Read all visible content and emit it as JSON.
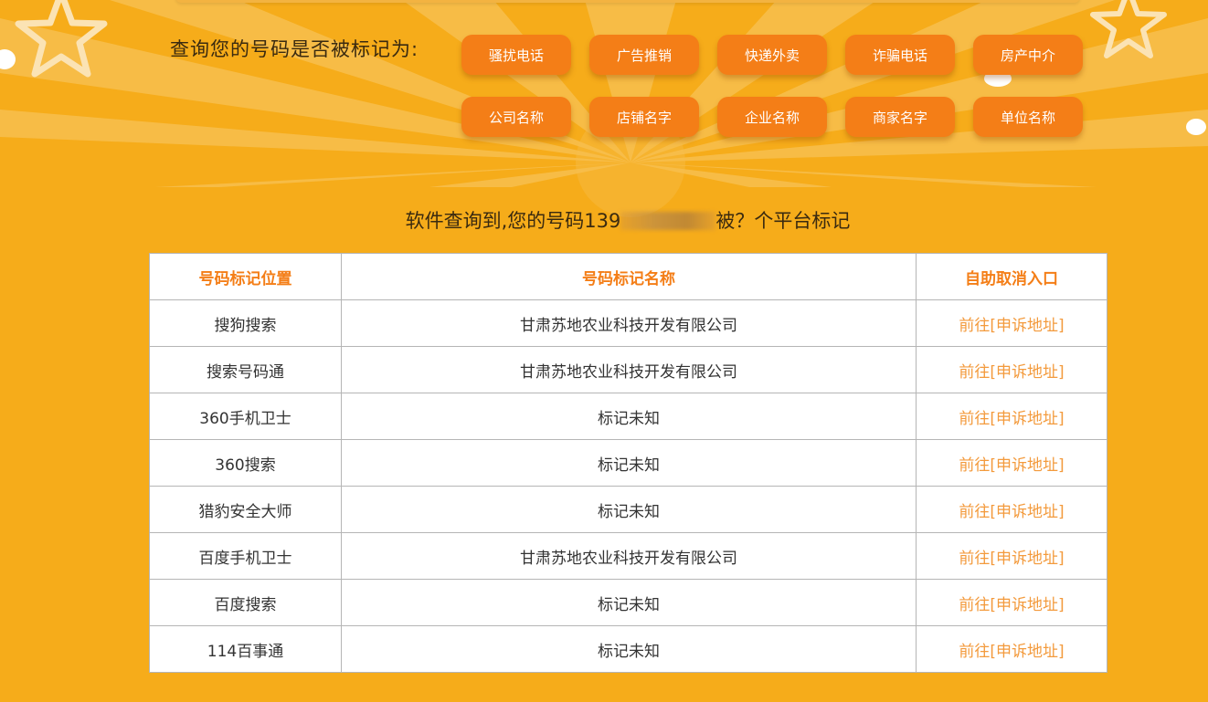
{
  "query": {
    "label": "查询您的号码是否被标记为:",
    "tags": [
      "骚扰电话",
      "广告推销",
      "快递外卖",
      "诈骗电话",
      "房产中介",
      "公司名称",
      "店铺名字",
      "企业名称",
      "商家名字",
      "单位名称"
    ]
  },
  "result": {
    "prefix": "软件查询到,您的号码139",
    "suffix": "被？个平台标记"
  },
  "table": {
    "headers": [
      "号码标记位置",
      "号码标记名称",
      "自助取消入口"
    ],
    "rows": [
      {
        "platform": "搜狗搜索",
        "mark": "甘肃苏地农业科技开发有限公司",
        "action": "前往[申诉地址]"
      },
      {
        "platform": "搜索号码通",
        "mark": "甘肃苏地农业科技开发有限公司",
        "action": "前往[申诉地址]"
      },
      {
        "platform": "360手机卫士",
        "mark": "标记未知",
        "action": "前往[申诉地址]"
      },
      {
        "platform": "360搜索",
        "mark": "标记未知",
        "action": "前往[申诉地址]"
      },
      {
        "platform": "猎豹安全大师",
        "mark": "标记未知",
        "action": "前往[申诉地址]"
      },
      {
        "platform": "百度手机卫士",
        "mark": "甘肃苏地农业科技开发有限公司",
        "action": "前往[申诉地址]"
      },
      {
        "platform": "百度搜索",
        "mark": "标记未知",
        "action": "前往[申诉地址]"
      },
      {
        "platform": "114百事通",
        "mark": "标记未知",
        "action": "前往[申诉地址]"
      }
    ]
  },
  "colors": {
    "background": "#f6ac1a",
    "button": "#f47e17",
    "header_text": "#f47e17",
    "link_text": "#f39a3c"
  },
  "icons": [
    "star-icon",
    "dot-icon"
  ]
}
